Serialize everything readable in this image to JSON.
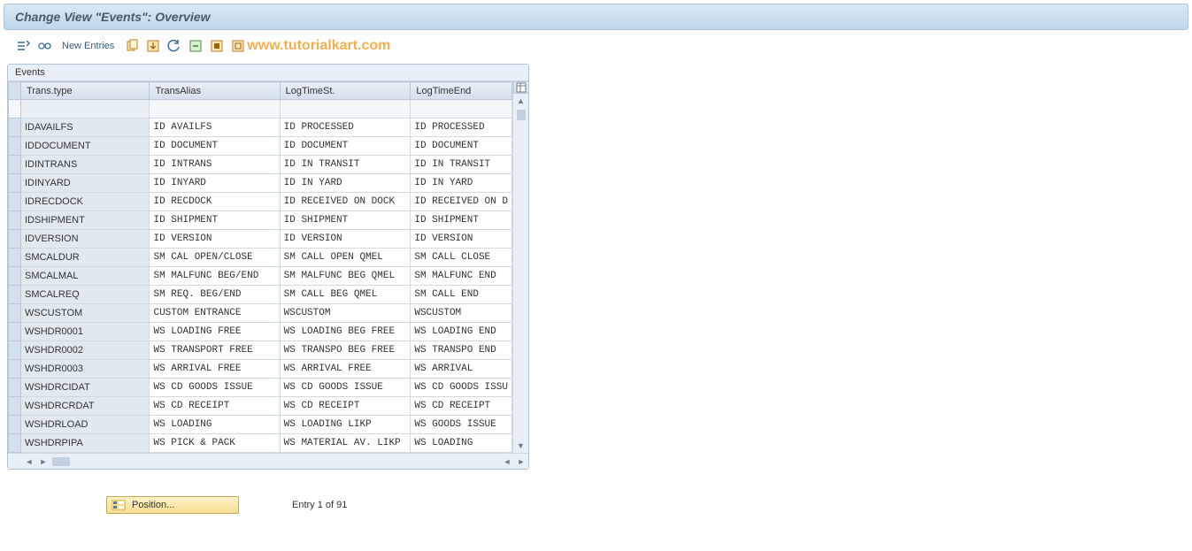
{
  "title": "Change View \"Events\": Overview",
  "toolbar": {
    "new_entries": "New Entries",
    "watermark": "www.tutorialkart.com"
  },
  "panel": {
    "heading": "Events",
    "columns": {
      "trans_type": "Trans.type",
      "trans_alias": "TransAlias",
      "log_time_st": "LogTimeSt.",
      "log_time_end": "LogTimeEnd"
    },
    "rows": [
      {
        "tt": "IDAVAILFS",
        "ta": "ID AVAILFS",
        "ls": "ID PROCESSED",
        "le": "ID PROCESSED"
      },
      {
        "tt": "IDDOCUMENT",
        "ta": "ID DOCUMENT",
        "ls": "ID DOCUMENT",
        "le": "ID DOCUMENT"
      },
      {
        "tt": "IDINTRANS",
        "ta": "ID INTRANS",
        "ls": "ID IN TRANSIT",
        "le": "ID IN TRANSIT"
      },
      {
        "tt": "IDINYARD",
        "ta": "ID INYARD",
        "ls": "ID IN YARD",
        "le": "ID IN YARD"
      },
      {
        "tt": "IDRECDOCK",
        "ta": "ID RECDOCK",
        "ls": "ID RECEIVED ON DOCK",
        "le": "ID RECEIVED ON D"
      },
      {
        "tt": "IDSHIPMENT",
        "ta": "ID SHIPMENT",
        "ls": "ID SHIPMENT",
        "le": "ID SHIPMENT"
      },
      {
        "tt": "IDVERSION",
        "ta": "ID VERSION",
        "ls": "ID VERSION",
        "le": "ID VERSION"
      },
      {
        "tt": "SMCALDUR",
        "ta": "SM CAL OPEN/CLOSE",
        "ls": "SM CALL OPEN    QMEL",
        "le": "SM CALL CLOSE"
      },
      {
        "tt": "SMCALMAL",
        "ta": "SM MALFUNC BEG/END",
        "ls": "SM MALFUNC BEG  QMEL",
        "le": "SM MALFUNC END"
      },
      {
        "tt": "SMCALREQ",
        "ta": "SM REQ. BEG/END",
        "ls": "SM CALL BEG     QMEL",
        "le": "SM CALL END"
      },
      {
        "tt": "WSCUSTOM",
        "ta": "CUSTOM ENTRANCE",
        "ls": "WSCUSTOM",
        "le": "WSCUSTOM"
      },
      {
        "tt": "WSHDR0001",
        "ta": "WS LOADING      FREE",
        "ls": "WS LOADING BEG  FREE",
        "le": "WS LOADING END"
      },
      {
        "tt": "WSHDR0002",
        "ta": "WS TRANSPORT    FREE",
        "ls": "WS TRANSPO BEG  FREE",
        "le": "WS TRANSPO END"
      },
      {
        "tt": "WSHDR0003",
        "ta": "WS ARRIVAL      FREE",
        "ls": "WS ARRIVAL      FREE",
        "le": "WS ARRIVAL"
      },
      {
        "tt": "WSHDRCIDAT",
        "ta": "WS CD GOODS ISSUE",
        "ls": "WS CD GOODS ISSUE",
        "le": "WS CD GOODS ISSU"
      },
      {
        "tt": "WSHDRCRDAT",
        "ta": "WS CD RECEIPT",
        "ls": "WS CD RECEIPT",
        "le": "WS CD RECEIPT"
      },
      {
        "tt": "WSHDRLOAD",
        "ta": "WS LOADING",
        "ls": "WS LOADING      LIKP",
        "le": "WS GOODS ISSUE"
      },
      {
        "tt": "WSHDRPIPA",
        "ta": "WS PICK & PACK",
        "ls": "WS MATERIAL AV. LIKP",
        "le": "WS LOADING"
      }
    ]
  },
  "footer": {
    "position_label": "Position...",
    "entry_info": "Entry 1 of 91"
  }
}
